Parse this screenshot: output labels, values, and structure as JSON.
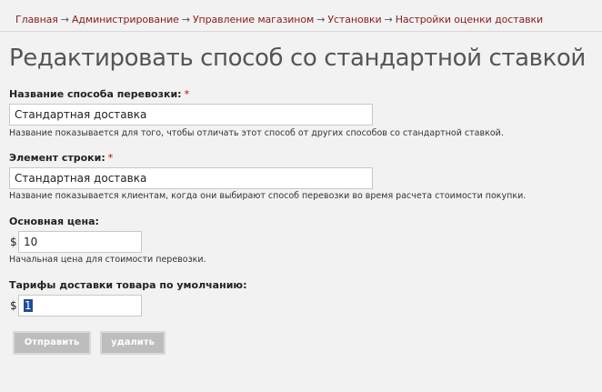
{
  "breadcrumb": {
    "items": [
      "Главная",
      "Администрирование",
      "Управление магазином",
      "Установки",
      "Настройки оценки доставки"
    ],
    "separator": "→"
  },
  "page_title": "Редактировать способ со стандартной ставкой",
  "form": {
    "method_name": {
      "label": "Название способа перевозки:",
      "required_mark": "*",
      "value": "Стандартная доставка",
      "help": "Название показывается для того, чтобы отличать этот способ от других способов со стандартной ставкой."
    },
    "line_item": {
      "label": "Элемент строки:",
      "required_mark": "*",
      "value": "Стандартная доставка",
      "help": "Название показывается клиентам, когда они выбирают способ перевозки во время расчета стоимости покупки."
    },
    "base_rate": {
      "label": "Основная цена:",
      "currency": "$",
      "value": "10",
      "help": "Начальная цена для стоимости перевозки."
    },
    "default_product_rate": {
      "label": "Тарифы доставки товара по умолчанию:",
      "currency": "$",
      "value": "1"
    }
  },
  "buttons": {
    "submit": "Отправить",
    "delete": "удалить"
  },
  "colors": {
    "link": "#8b1a1a",
    "required": "#cc0000",
    "button_bg": "#bdbdbd",
    "selection": "#1f4e9b"
  }
}
